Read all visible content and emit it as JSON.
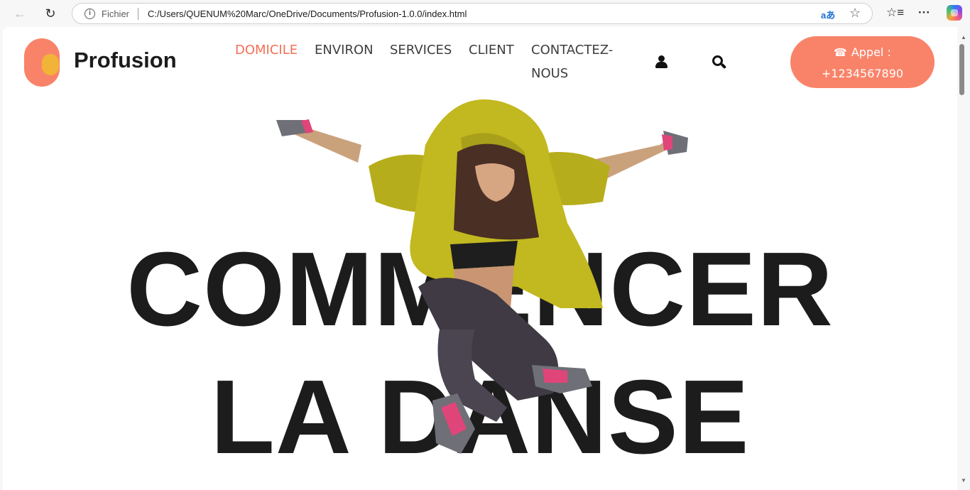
{
  "browser": {
    "scheme_label": "Fichier",
    "url": "C:/Users/QUENUM%20Marc/OneDrive/Documents/Profusion-1.0.0/index.html",
    "translate_glyph": "aあ"
  },
  "site": {
    "brand": "Profusion",
    "menu": {
      "home": "DOMICILE",
      "about": "ENVIRON",
      "services": "SERVICES",
      "client": "CLIENT",
      "contact": "CONTACTEZ-NOUS"
    },
    "call": {
      "label": "Appel :",
      "number": "+1234567890"
    },
    "colors": {
      "accent": "#f98369",
      "accent_text": "#f27055",
      "logo_inner": "#f2b438"
    }
  },
  "hero": {
    "line1": "COMMENCER",
    "line2": "LA DANSE",
    "image": "jumping-dancer-yellow-hoodie"
  }
}
